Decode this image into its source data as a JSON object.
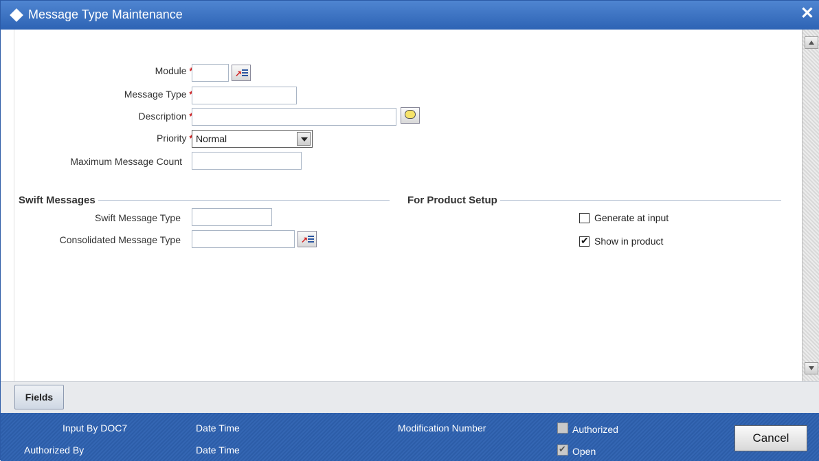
{
  "window": {
    "title": "Message Type Maintenance",
    "close_label": "✕"
  },
  "form": {
    "module_label": "Module",
    "message_type_label": "Message Type",
    "description_label": "Description",
    "priority_label": "Priority",
    "priority_value": "Normal",
    "max_count_label": "Maximum Message Count",
    "required_mark": "*"
  },
  "swift": {
    "section_title": "Swift Messages",
    "swift_type_label": "Swift Message Type",
    "consolidated_label": "Consolidated Message Type"
  },
  "product_setup": {
    "section_title": "For Product Setup",
    "generate_label": "Generate at input",
    "generate_checked": false,
    "show_label": "Show in product",
    "show_checked": true
  },
  "tabs": {
    "fields_label": "Fields"
  },
  "footer": {
    "input_by": "Input By DOC7",
    "authorized_by": "Authorized By",
    "date_time_1": "Date Time",
    "date_time_2": "Date Time",
    "modification_number": "Modification Number",
    "authorized_label": "Authorized",
    "open_label": "Open",
    "cancel_label": "Cancel"
  },
  "icons": {
    "titlebar": "diamond-icon",
    "lov": "list-of-values-icon",
    "description": "speech-bubble-icon"
  }
}
